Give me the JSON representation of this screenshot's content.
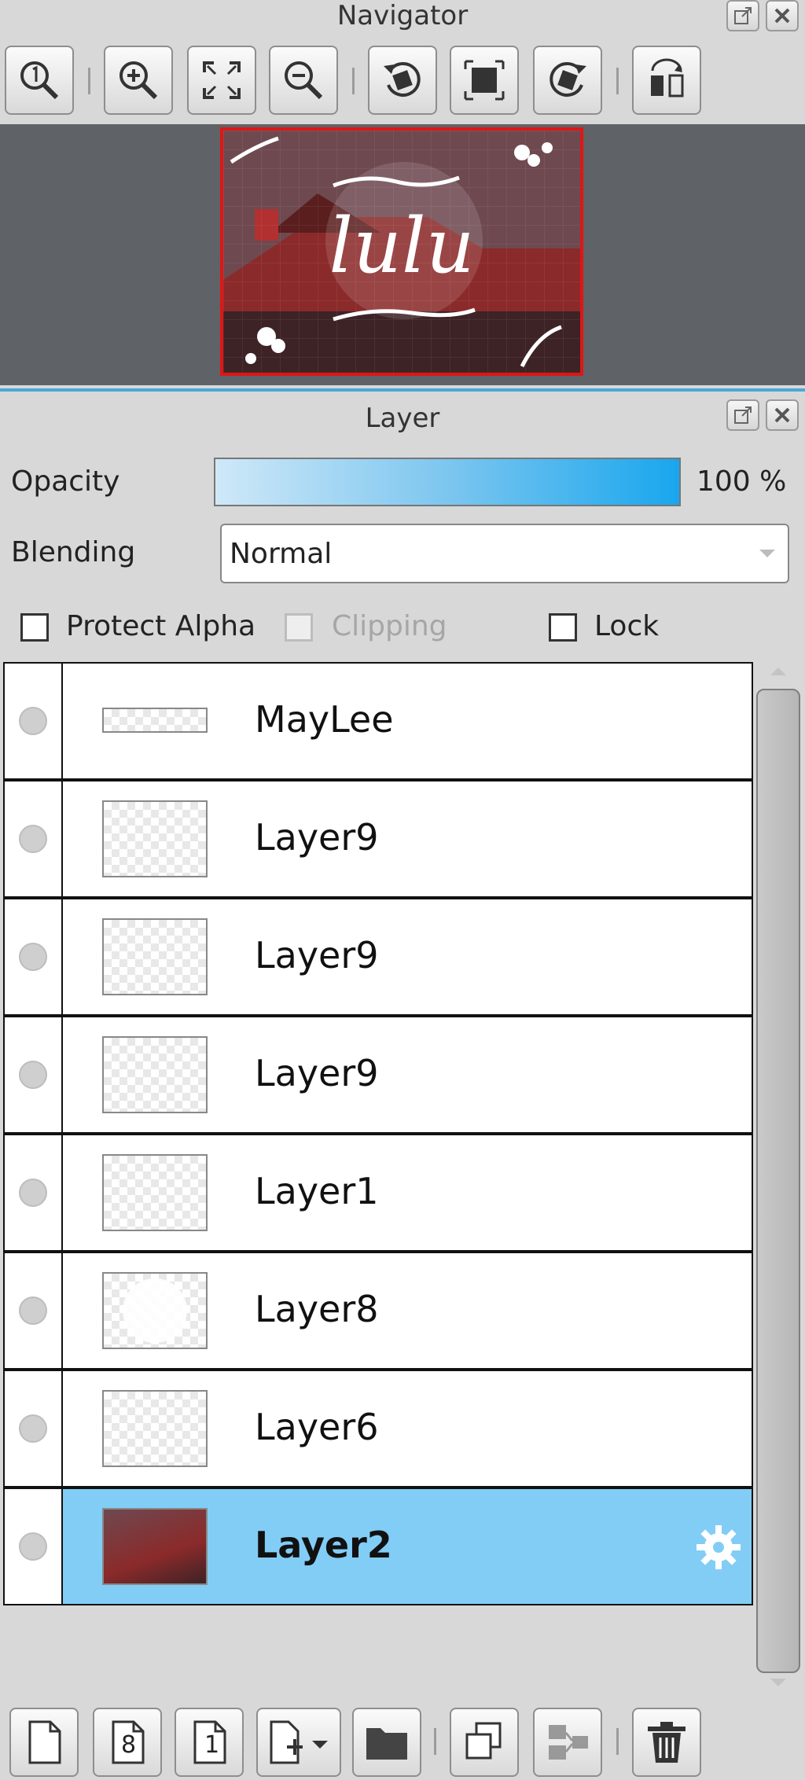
{
  "navigator": {
    "title": "Navigator",
    "toolbar_icons": [
      "zoom-actual-icon",
      "zoom-in-icon",
      "fit-screen-icon",
      "zoom-out-icon",
      "rotate-left-icon",
      "fit-width-icon",
      "rotate-right-icon",
      "flip-icon"
    ]
  },
  "layer_panel": {
    "title": "Layer",
    "opacity_label": "Opacity",
    "opacity_value": "100 %",
    "opacity_percent": 100,
    "blending_label": "Blending",
    "blending_value": "Normal",
    "protect_alpha_label": "Protect Alpha",
    "clipping_label": "Clipping",
    "lock_label": "Lock",
    "layers": [
      {
        "name": "MayLee"
      },
      {
        "name": "Layer9"
      },
      {
        "name": "Layer9"
      },
      {
        "name": "Layer9"
      },
      {
        "name": "Layer1"
      },
      {
        "name": "Layer8"
      },
      {
        "name": "Layer6"
      },
      {
        "name": "Layer2",
        "selected": true
      }
    ],
    "bottom_toolbar_icons": [
      "new-layer-icon",
      "new-8bit-layer-icon",
      "new-1bit-layer-icon",
      "add-layer-menu-icon",
      "new-folder-icon",
      "duplicate-layer-icon",
      "merge-down-icon",
      "delete-layer-icon"
    ],
    "bottom_labels": {
      "eight": "8",
      "one": "1"
    }
  },
  "colors": {
    "selected_row": "#82cdf6",
    "accent": "#4aa8d8",
    "nav_frame": "#e01515"
  }
}
